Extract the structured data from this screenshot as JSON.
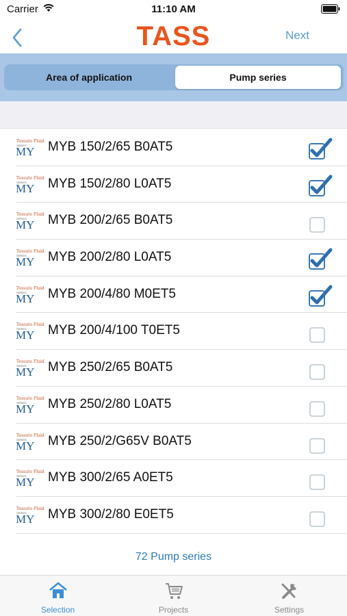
{
  "status": {
    "carrier": "Carrier",
    "time": "11:10 AM"
  },
  "nav": {
    "brand": "TASS",
    "next_label": "Next",
    "accent": "#5b9bd5",
    "brand_color": "#e8561e"
  },
  "segments": {
    "area_label": "Area of application",
    "pump_label": "Pump series",
    "selected": "Pump series"
  },
  "logo": {
    "maker": "Tessuto Fluid",
    "series_small": "SERIES",
    "series": "MY"
  },
  "pumps": [
    {
      "name": "MYB 150/2/65 B0AT5",
      "checked": true
    },
    {
      "name": "MYB 150/2/80 L0AT5",
      "checked": true
    },
    {
      "name": "MYB 200/2/65 B0AT5",
      "checked": false
    },
    {
      "name": "MYB 200/2/80 L0AT5",
      "checked": true
    },
    {
      "name": "MYB 200/4/80 M0ET5",
      "checked": true
    },
    {
      "name": "MYB 200/4/100 T0ET5",
      "checked": false
    },
    {
      "name": "MYB 250/2/65 B0AT5",
      "checked": false
    },
    {
      "name": "MYB 250/2/80 L0AT5",
      "checked": false
    },
    {
      "name": "MYB 250/2/G65V B0AT5",
      "checked": false
    },
    {
      "name": "MYB 300/2/65 A0ET5",
      "checked": false
    },
    {
      "name": "MYB 300/2/80 E0ET5",
      "checked": false
    }
  ],
  "count_label": "72 Pump series",
  "tabs": [
    {
      "label": "Selection",
      "icon": "home-icon",
      "active": true
    },
    {
      "label": "Projects",
      "icon": "cart-icon",
      "active": false
    },
    {
      "label": "Settings",
      "icon": "tools-icon",
      "active": false
    }
  ]
}
